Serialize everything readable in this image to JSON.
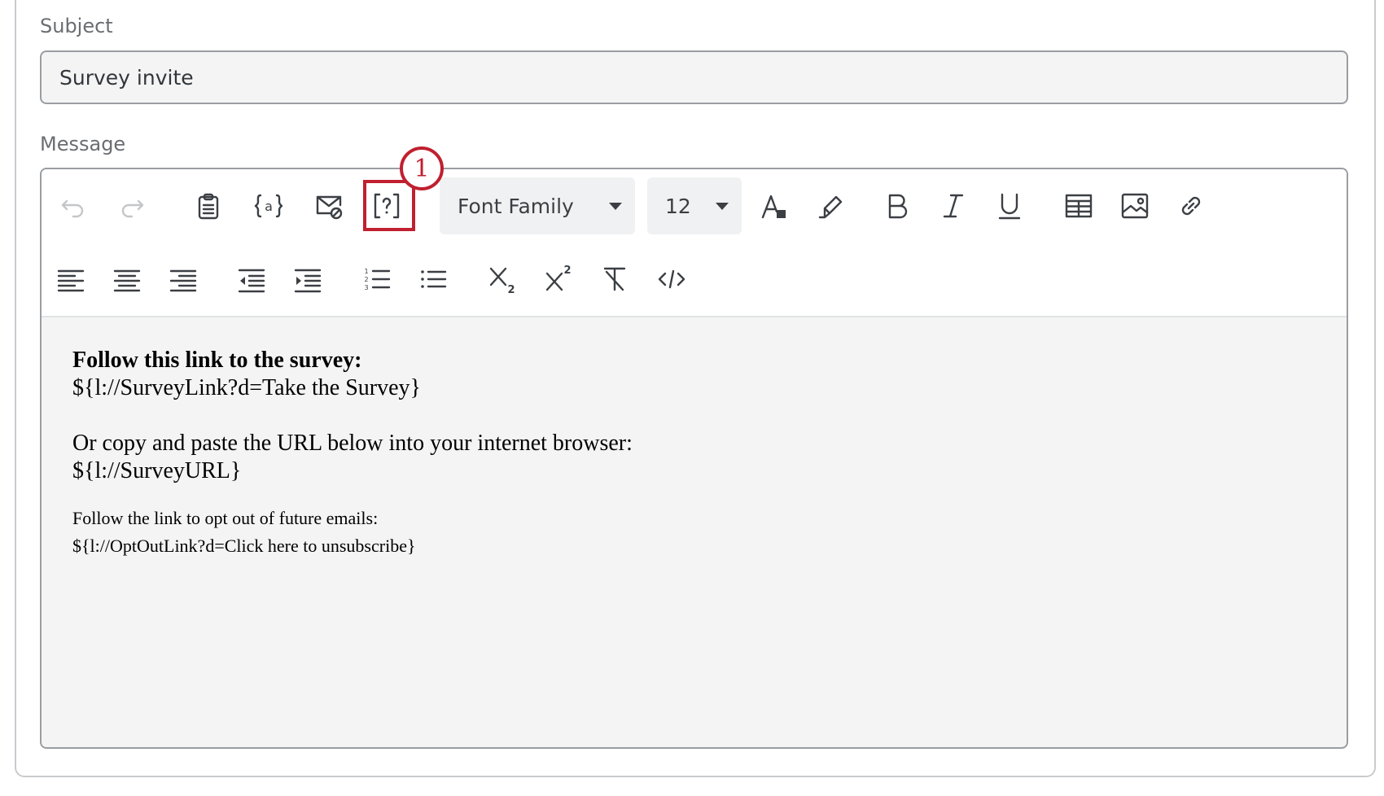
{
  "subject": {
    "label": "Subject",
    "value": "Survey invite"
  },
  "message": {
    "label": "Message",
    "toolbar": {
      "font_family": "Font Family",
      "font_size": "12",
      "row1_icons": [
        "undo-icon",
        "redo-icon",
        "paste-icon",
        "piped-text-icon",
        "email-blocked-icon",
        "insert-question-icon",
        "font-color-icon",
        "highlight-icon",
        "bold-icon",
        "italic-icon",
        "underline-icon",
        "table-icon",
        "image-icon",
        "link-icon"
      ],
      "row2_icons": [
        "align-left-icon",
        "align-center-icon",
        "align-right-icon",
        "outdent-icon",
        "indent-icon",
        "ordered-list-icon",
        "unordered-list-icon",
        "subscript-icon",
        "superscript-icon",
        "clear-format-icon",
        "source-code-icon"
      ]
    },
    "body": {
      "line1": "Follow this link to the survey:",
      "line2": "${l://SurveyLink?d=Take the Survey}",
      "line3": "Or copy and paste the URL below into your internet browser:",
      "line4": "${l://SurveyURL}",
      "line5": "Follow the link to opt out of future emails:",
      "line6": "${l://OptOutLink?d=Click here to unsubscribe}"
    }
  },
  "annotation": {
    "step": "1",
    "color": "#c0202f"
  }
}
